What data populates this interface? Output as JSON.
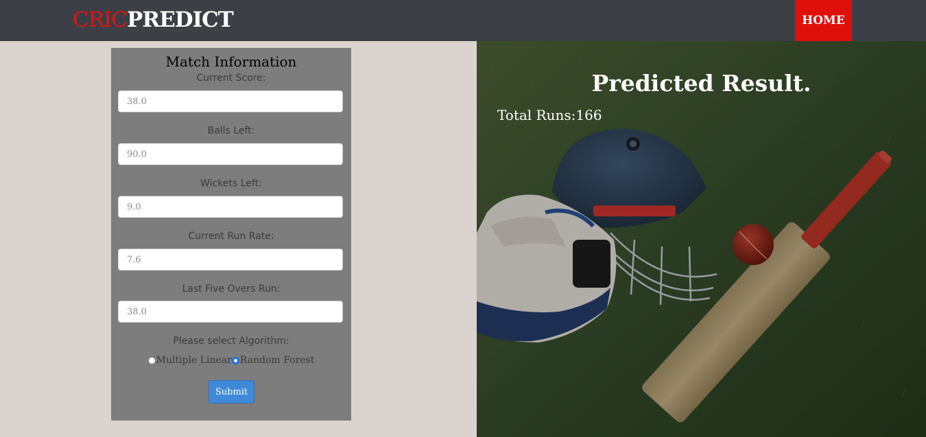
{
  "brand": {
    "part1": "CRIC",
    "part2": "PREDICT"
  },
  "nav": {
    "home_label": "HOME"
  },
  "form": {
    "title": "Match Information",
    "fields": [
      {
        "label": "Current Score:",
        "value": "38.0"
      },
      {
        "label": "Balls Left:",
        "value": "90.0"
      },
      {
        "label": "Wickets Left:",
        "value": "9.0"
      },
      {
        "label": "Current Run Rate:",
        "value": "7.6"
      },
      {
        "label": "Last Five Overs Run:",
        "value": "38.0"
      }
    ],
    "algorithm_label": "Please select Algorithm:",
    "algorithms": [
      {
        "label": "Multiple Linear",
        "checked": false
      },
      {
        "label": "Random Forest",
        "checked": true
      }
    ],
    "submit_label": "Submit"
  },
  "result": {
    "title": "Predicted Result.",
    "total_runs": "Total Runs:166"
  },
  "colors": {
    "navbar": "#3c3f45",
    "brand_red": "#e01414",
    "home_red": "#df0f0b",
    "panel": "#7d7d7d",
    "submit_blue": "#3f8ad8"
  }
}
